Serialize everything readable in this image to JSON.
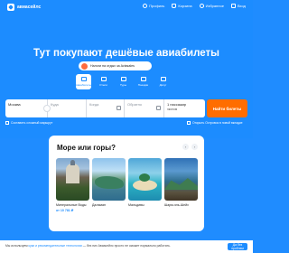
{
  "header": {
    "logo_text": "авиасейлс",
    "nav": [
      {
        "label": "Профиль",
        "icon": "user-icon"
      },
      {
        "label": "Корзина",
        "icon": "cart-icon"
      },
      {
        "label": "Избранное",
        "icon": "heart-icon"
      },
      {
        "label": "Вход",
        "icon": "login-icon"
      }
    ]
  },
  "hero": {
    "title": "Тут покупают дешёвые авиабилеты",
    "promo": "Налоги на отдых за Aviasales"
  },
  "tabs": [
    {
      "label": "Авиабилеты",
      "icon": "plane-icon",
      "active": true
    },
    {
      "label": "Отели",
      "icon": "bed-icon",
      "active": false
    },
    {
      "label": "Туры",
      "icon": "palm-icon",
      "active": false
    },
    {
      "label": "Поездки",
      "icon": "bag-icon",
      "active": false
    },
    {
      "label": "Досуг",
      "icon": "ticket-icon",
      "active": false
    }
  ],
  "search": {
    "origin": "Москва",
    "destination_placeholder": "Куда",
    "date_placeholder": "Когда",
    "return_placeholder": "Обратно",
    "passengers": "1 пассажир",
    "class": "эконом",
    "find_button": "Найти билеты"
  },
  "options": {
    "complex_route": "Составить сложный маршрут",
    "open_booking": "Открыть Островок в новой вкладке"
  },
  "card": {
    "title": "Море или горы?",
    "prev": "‹",
    "next": "›",
    "destinations": [
      {
        "name": "Минеральные Воды",
        "price": "от 10 781 ₽"
      },
      {
        "name": "Даламан",
        "price": ""
      },
      {
        "name": "Мальдивы",
        "price": ""
      },
      {
        "name": "Шарм-эль-Шейх",
        "price": ""
      }
    ]
  },
  "cookie": {
    "text_before": "Мы используем",
    "link_text": "куки и рекомендательные технологии",
    "text_after": "— без них Авиасейлс просто не сможет нормально работать.",
    "button": "Да без проблем"
  },
  "colors": {
    "brand_blue": "#1c8cff",
    "cta_orange": "#ff6d00"
  }
}
